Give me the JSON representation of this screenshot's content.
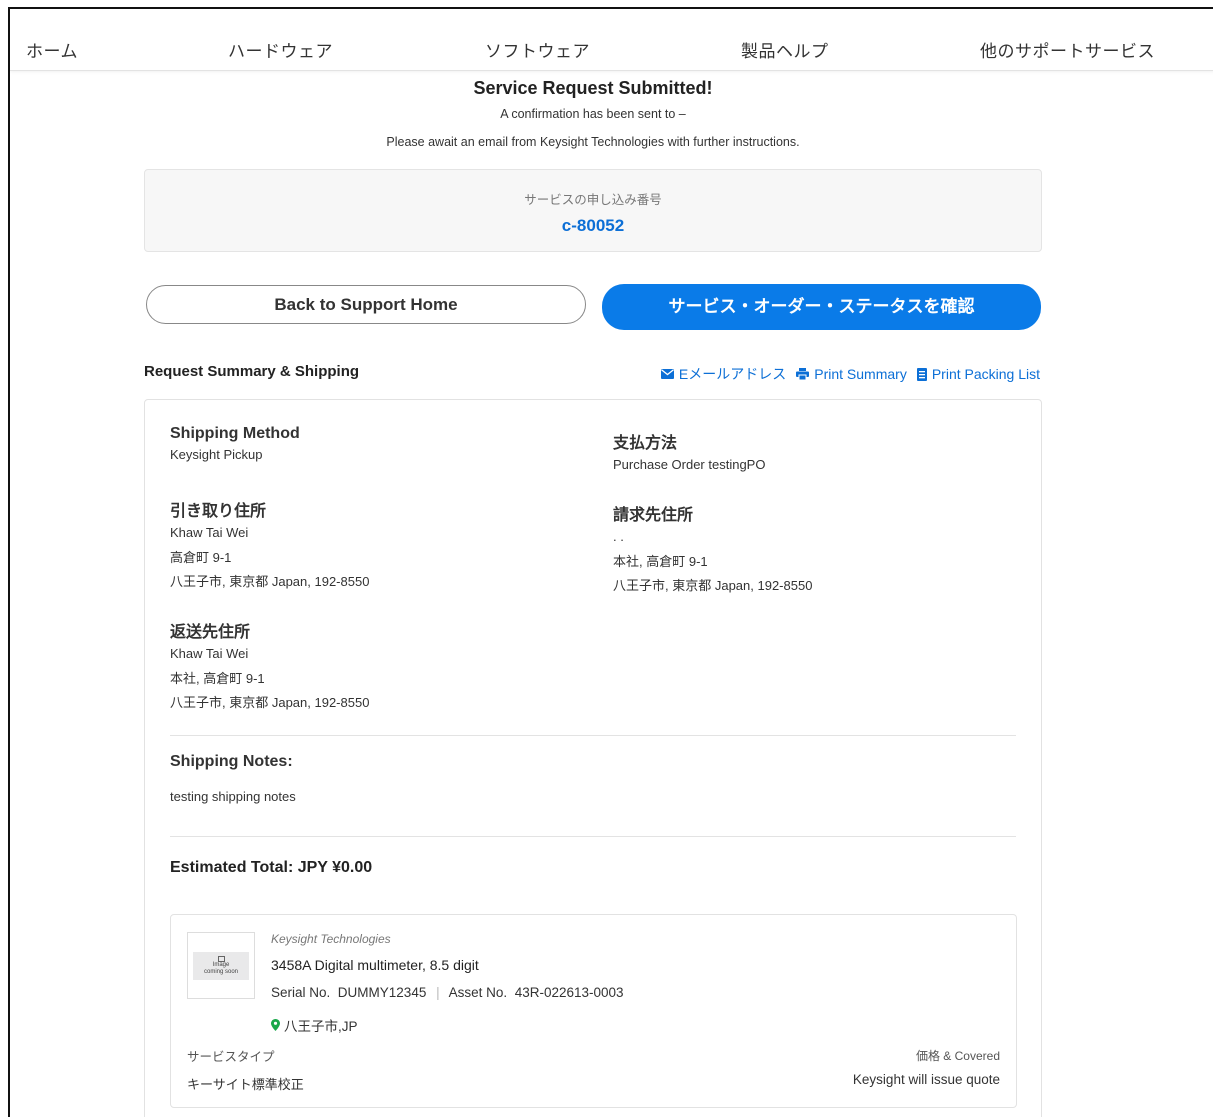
{
  "nav": {
    "items": [
      "ホーム",
      "ハードウェア",
      "ソフトウェア",
      "製品ヘルプ",
      "他のサポートサービス"
    ]
  },
  "confirmation": {
    "title": "Service Request Submitted!",
    "line1": "A confirmation has been sent to –",
    "line2": "Please await an email from Keysight Technologies with further instructions."
  },
  "request": {
    "label": "サービスの申し込み番号",
    "number": "c-80052"
  },
  "buttons": {
    "back": "Back to Support Home",
    "status": "サービス・オーダー・ステータスを確認"
  },
  "summary": {
    "title": "Request Summary & Shipping",
    "actions": {
      "email": "Eメールアドレス",
      "print_summary": "Print Summary",
      "print_packing": "Print Packing List"
    }
  },
  "shipping": {
    "method_label": "Shipping Method",
    "method_value": "Keysight Pickup",
    "pickup_label": "引き取り住所",
    "pickup_lines": [
      "Khaw Tai Wei",
      "高倉町 9-1",
      "八王子市, 東京都 Japan, 192-8550"
    ],
    "return_label": "返送先住所",
    "return_lines": [
      "Khaw Tai Wei",
      "本社, 高倉町 9-1",
      "八王子市, 東京都 Japan, 192-8550"
    ],
    "payment_label": "支払方法",
    "payment_value": "Purchase Order testingPO",
    "billing_label": "請求先住所",
    "billing_lines": [
      ". .",
      "本社, 高倉町 9-1",
      "八王子市, 東京都 Japan, 192-8550"
    ],
    "notes_label": "Shipping Notes:",
    "notes_value": "testing shipping notes",
    "total": "Estimated Total:  JPY ¥0.00"
  },
  "item": {
    "thumb_text": "Image\ncoming soon",
    "brand": "Keysight Technologies",
    "model": "3458A Digital multimeter, 8.5 digit",
    "serial_label": "Serial No.",
    "serial": "DUMMY12345",
    "asset_label": "Asset No.",
    "asset": "43R-022613-0003",
    "location": "八王子市,JP",
    "service_type_label": "サービスタイプ",
    "service_type": "キーサイト標準校正",
    "price_label": "価格 & Covered",
    "price_value": "Keysight will issue quote"
  },
  "colors": {
    "accent": "#0a7be8",
    "link": "#0c6fd6",
    "location_pin": "#1aa84a"
  }
}
